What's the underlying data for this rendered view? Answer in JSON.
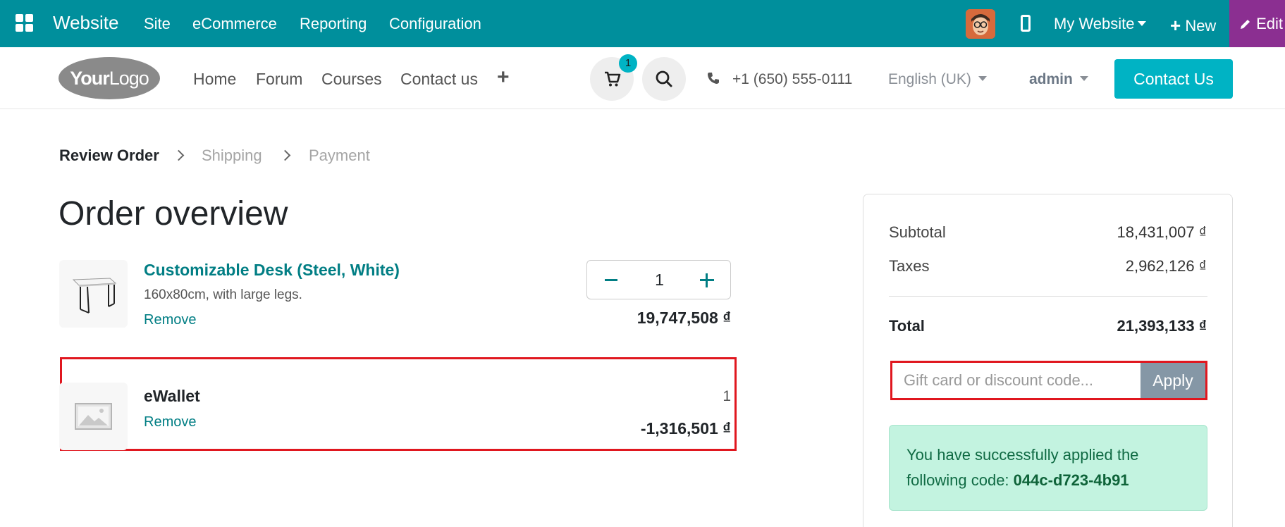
{
  "topbar": {
    "app_name": "Website",
    "menu": [
      "Site",
      "eCommerce",
      "Reporting",
      "Configuration"
    ],
    "website_selector": "My Website",
    "new_label": "New",
    "edit_label": "Edit",
    "bg_color": "#008f9c",
    "edit_color": "#8b2f91"
  },
  "header": {
    "logo_bold": "Your",
    "logo_thin": "Logo",
    "nav": [
      "Home",
      "Forum",
      "Courses",
      "Contact us"
    ],
    "cart_count": "1",
    "phone": "+1 (650) 555-0111",
    "language": "English (UK)",
    "user": "admin",
    "contact_button": "Contact Us",
    "accent_color": "#00b3c4"
  },
  "breadcrumb": {
    "steps": [
      "Review Order",
      "Shipping",
      "Payment"
    ],
    "active_index": 0
  },
  "page_title": "Order overview",
  "order_lines": [
    {
      "name": "Customizable Desk (Steel, White)",
      "description": "160x80cm, with large legs.",
      "remove": "Remove",
      "quantity": "1",
      "price": "19,747,508 ₫"
    },
    {
      "name": "eWallet",
      "remove": "Remove",
      "quantity": "1",
      "price": "-1,316,501 ₫"
    }
  ],
  "summary": {
    "subtotal_label": "Subtotal",
    "subtotal_value": "18,431,007 ₫",
    "taxes_label": "Taxes",
    "taxes_value": "2,962,126 ₫",
    "total_label": "Total",
    "total_value": "21,393,133 ₫",
    "promo_placeholder": "Gift card or discount code...",
    "apply_label": "Apply",
    "success_text": "You have successfully applied the following code:",
    "success_code": "044c-d723-4b91"
  }
}
